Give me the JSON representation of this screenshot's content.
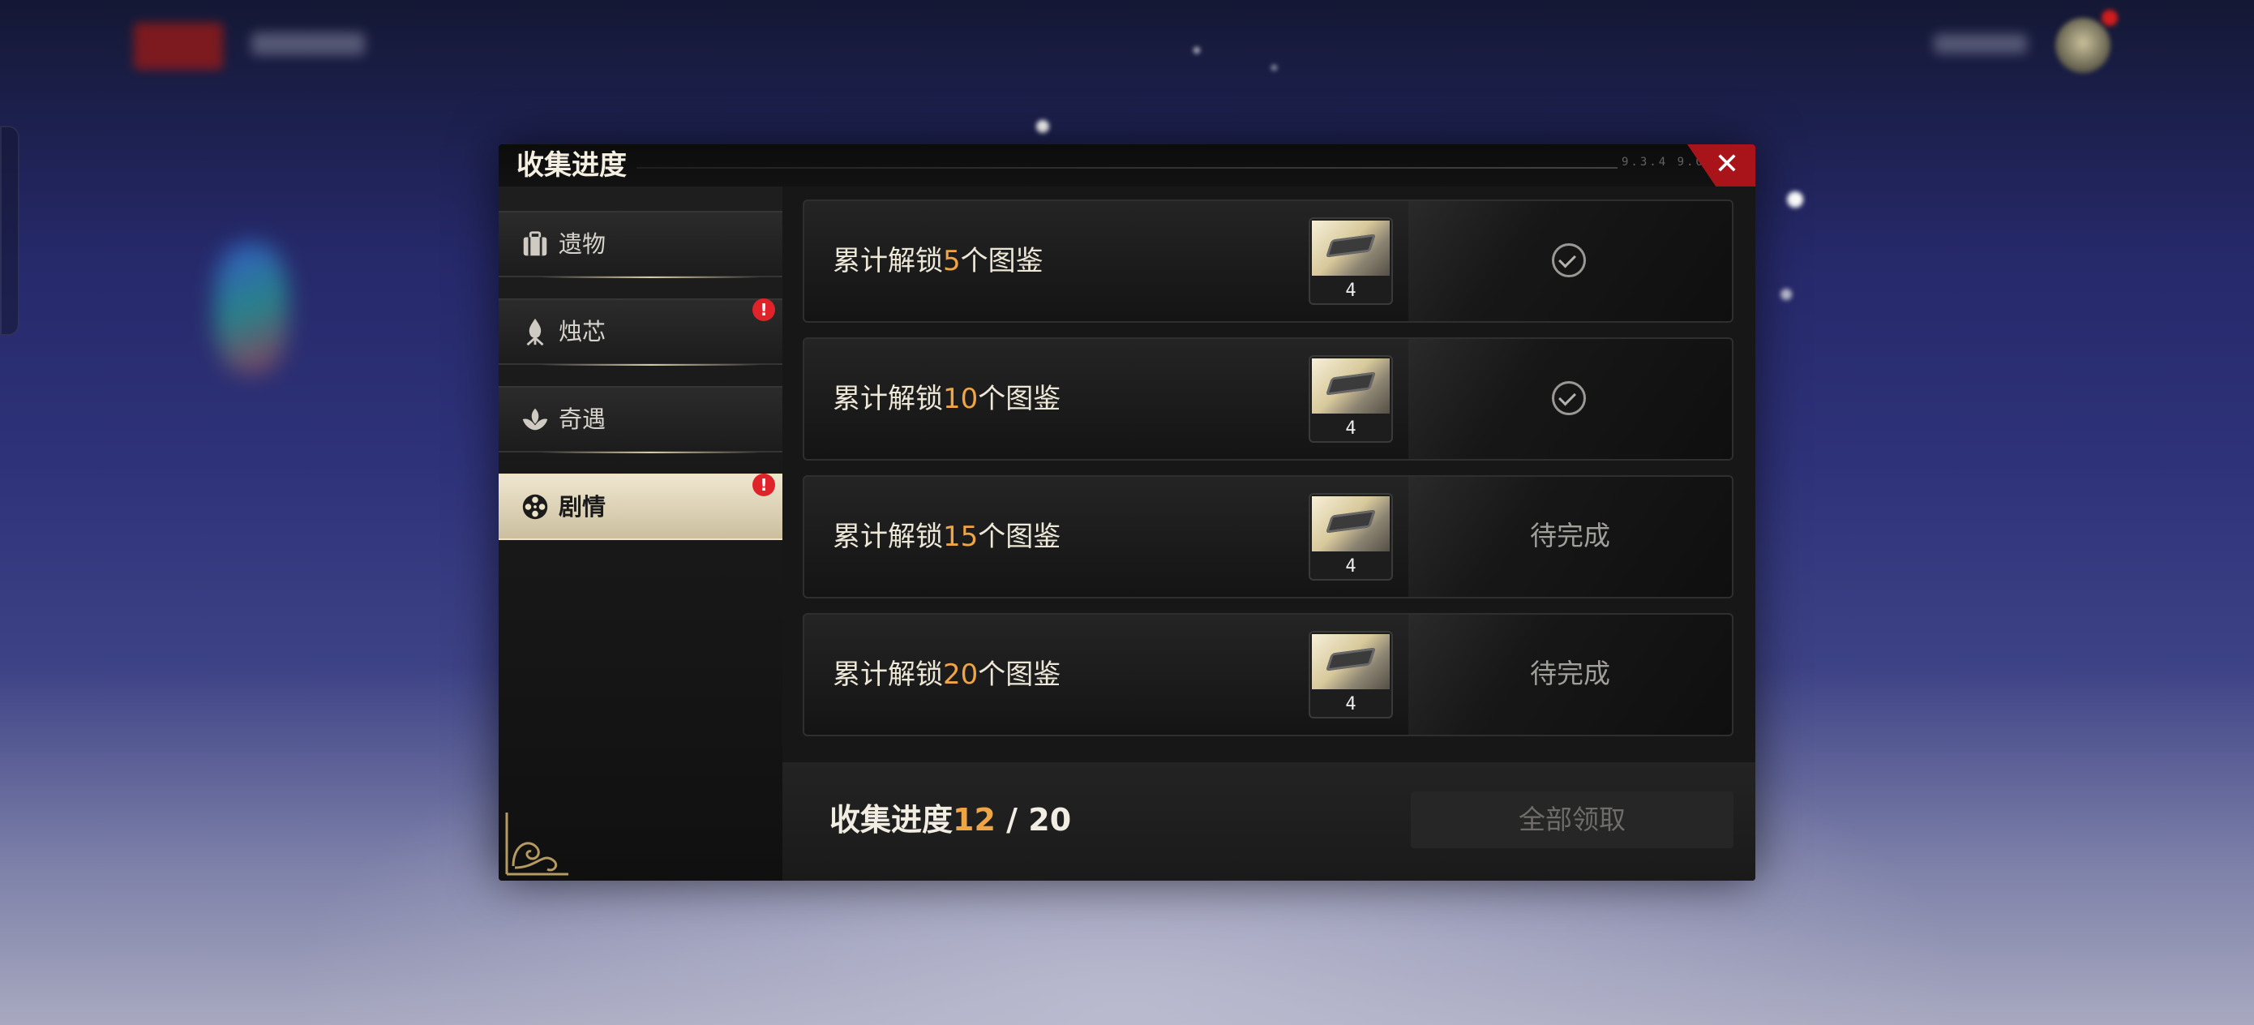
{
  "modal": {
    "title": "收集进度",
    "header_code": "9.3.4 9.0",
    "close_symbol": "✕"
  },
  "tabs": [
    {
      "label": "遗物",
      "icon": "suitcase-icon",
      "badge": "",
      "active": false
    },
    {
      "label": "烛芯",
      "icon": "flame-icon",
      "badge": "!",
      "active": false
    },
    {
      "label": "奇遇",
      "icon": "lotus-icon",
      "badge": "",
      "active": false
    },
    {
      "label": "剧情",
      "icon": "film-reel-icon",
      "badge": "!",
      "active": true
    }
  ],
  "milestones": [
    {
      "prefix": "累计解锁",
      "count": "5",
      "suffix": "个图鉴",
      "reward_qty": "4",
      "status": "claimed",
      "status_text": ""
    },
    {
      "prefix": "累计解锁",
      "count": "10",
      "suffix": "个图鉴",
      "reward_qty": "4",
      "status": "claimed",
      "status_text": ""
    },
    {
      "prefix": "累计解锁",
      "count": "15",
      "suffix": "个图鉴",
      "reward_qty": "4",
      "status": "pending",
      "status_text": "待完成"
    },
    {
      "prefix": "累计解锁",
      "count": "20",
      "suffix": "个图鉴",
      "reward_qty": "4",
      "status": "pending",
      "status_text": "待完成"
    }
  ],
  "footer": {
    "progress_label": "收集进度",
    "progress_current": "12",
    "progress_separator": " / ",
    "progress_total": "20",
    "claim_all_label": "全部领取"
  },
  "colors": {
    "accent_orange": "#f0a545",
    "close_red": "#a8141a",
    "badge_red": "#e0222a",
    "active_tab": "#efe6cf"
  }
}
